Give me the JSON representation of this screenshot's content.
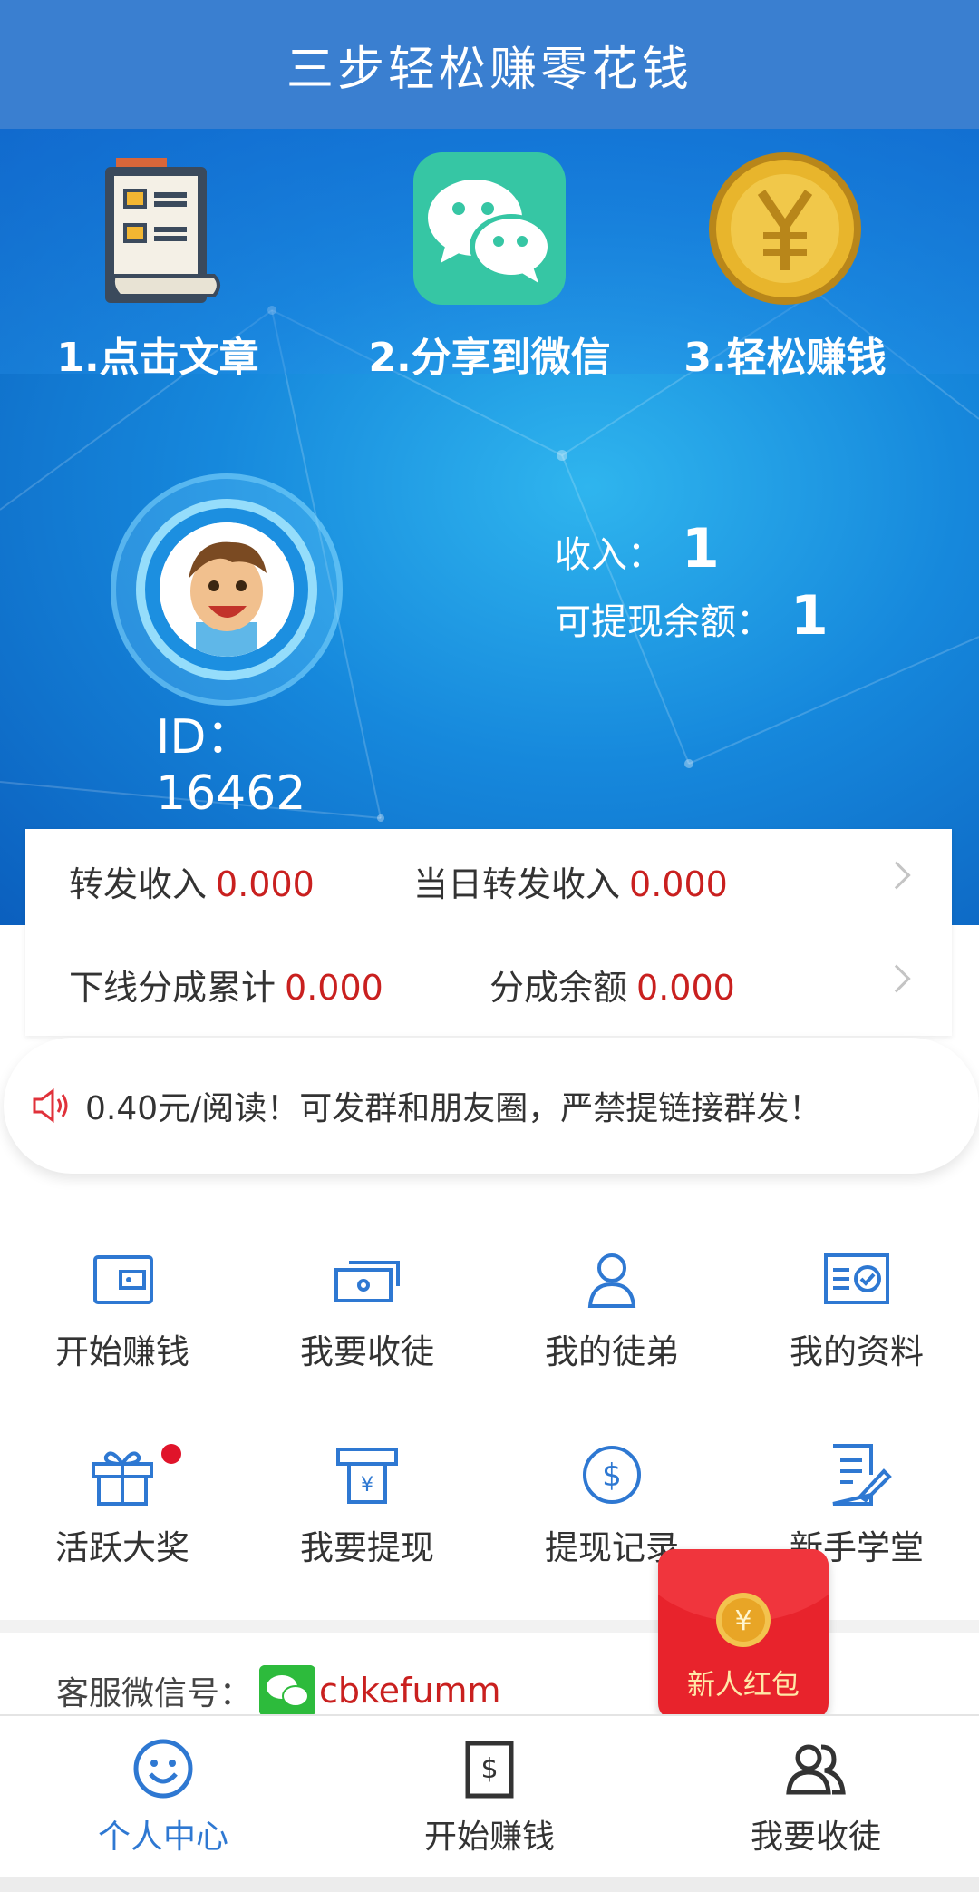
{
  "header": {
    "title": "三步轻松赚零花钱"
  },
  "steps": [
    {
      "label": "1.点击文章",
      "icon": "document-list-icon"
    },
    {
      "label": "2.分享到微信",
      "icon": "wechat-icon"
    },
    {
      "label": "3.轻松赚钱",
      "icon": "yuan-coin-icon"
    }
  ],
  "profile": {
    "income_label": "收入：",
    "income_value": "1",
    "balance_label": "可提现余额：",
    "balance_value": "1",
    "id_label": "ID：",
    "id_value": "16462"
  },
  "stats": {
    "forward_income_label": "转发收入",
    "forward_income_value": "0.000",
    "daily_forward_label": "当日转发收入",
    "daily_forward_value": "0.000",
    "downline_total_label": "下线分成累计",
    "downline_total_value": "0.000",
    "share_balance_label": "分成余额",
    "share_balance_value": "0.000"
  },
  "notice": {
    "text": "0.40元/阅读！可发群和朋友圈，严禁提链接群发！"
  },
  "menu": [
    {
      "label": "开始赚钱",
      "icon": "wallet-icon"
    },
    {
      "label": "我要收徒",
      "icon": "cash-icon"
    },
    {
      "label": "我的徒弟",
      "icon": "user-icon"
    },
    {
      "label": "我的资料",
      "icon": "profile-card-icon"
    },
    {
      "label": "活跃大奖",
      "icon": "gift-icon"
    },
    {
      "label": "我要提现",
      "icon": "atm-withdraw-icon"
    },
    {
      "label": "提现记录",
      "icon": "dollar-circle-icon"
    },
    {
      "label": "新手学堂",
      "icon": "note-pen-icon"
    }
  ],
  "service": {
    "label": "客服微信号：",
    "wechat_id": "cbkefumm"
  },
  "red_envelope": {
    "label": "新人红包"
  },
  "bottom_nav": [
    {
      "label": "个人中心",
      "icon": "smile-icon",
      "active": true
    },
    {
      "label": "开始赚钱",
      "icon": "dollar-card-icon",
      "active": false
    },
    {
      "label": "我要收徒",
      "icon": "users-icon",
      "active": false
    }
  ],
  "colors": {
    "primary": "#3a7fd0",
    "accent_red": "#c9201f",
    "nav_active": "#2e78d2",
    "icon_blue": "#2e78d2"
  }
}
